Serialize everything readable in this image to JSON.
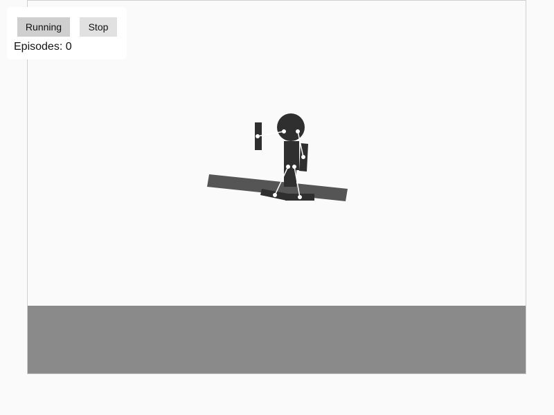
{
  "controls": {
    "running_label": "Running",
    "stop_label": "Stop",
    "episodes_label": "Episodes:",
    "episodes_count": "0"
  },
  "colors": {
    "page_background": "#fafafa",
    "ground": "#8a8a8a",
    "platform": "#555555",
    "body": "#2f2f2f",
    "joint": "#ffffff",
    "frame_border": "#cfcfcf"
  }
}
